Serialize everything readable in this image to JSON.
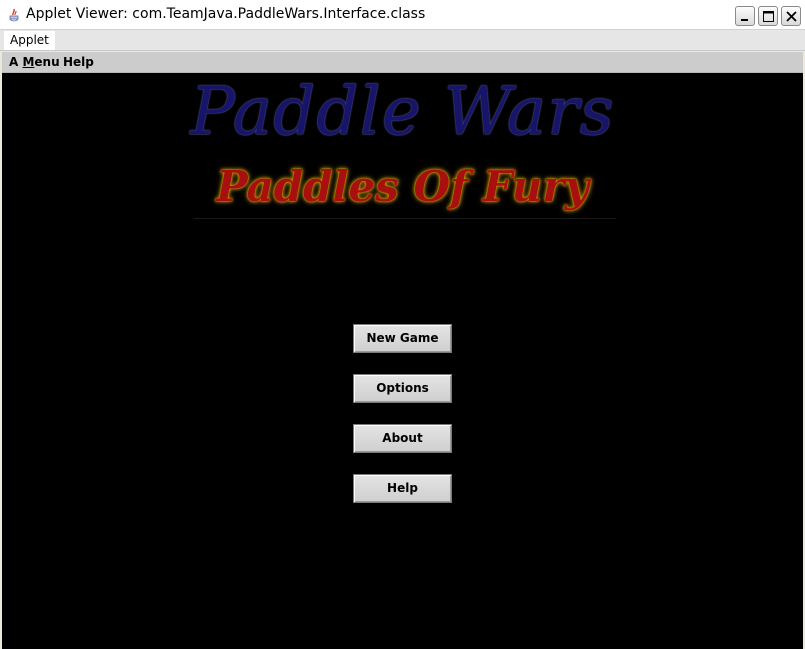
{
  "window": {
    "title": "Applet Viewer: com.TeamJava.PaddleWars.Interface.class"
  },
  "applet_tab": {
    "label": "Applet"
  },
  "menubar": {
    "items": [
      {
        "label_pre": "A ",
        "label_mnemonic": "M",
        "label_post": "enu"
      },
      {
        "label": "Help"
      }
    ]
  },
  "game": {
    "title": "Paddle Wars",
    "subtitle": "Paddles Of Fury",
    "buttons": {
      "new_game": "New Game",
      "options": "Options",
      "about": "About",
      "help": "Help"
    }
  },
  "colors": {
    "title": "#17156a",
    "subtitle": "#a81010",
    "subtitle_glow": "#d6a400",
    "background": "#000000"
  }
}
